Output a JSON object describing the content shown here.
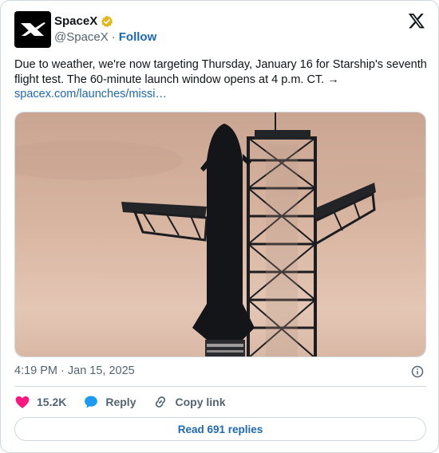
{
  "author": {
    "name": "SpaceX",
    "handle": "@SpaceX",
    "separator": "·",
    "follow_label": "Follow"
  },
  "tweet": {
    "text": "Due to weather, we're now targeting Thursday, January 16 for Starship's seventh flight test. The 60-minute launch window opens at 4 p.m. CT. →",
    "link": "spacex.com/launches/missi…",
    "timestamp": "4:19 PM · Jan 15, 2025"
  },
  "actions": {
    "likes": "15.2K",
    "reply_label": "Reply",
    "copy_label": "Copy link"
  },
  "read_replies_label": "Read 691 replies",
  "colors": {
    "link": "#1d68b5",
    "like": "#f91880",
    "reply": "#1d9bf0",
    "badge": "#e2b719"
  }
}
